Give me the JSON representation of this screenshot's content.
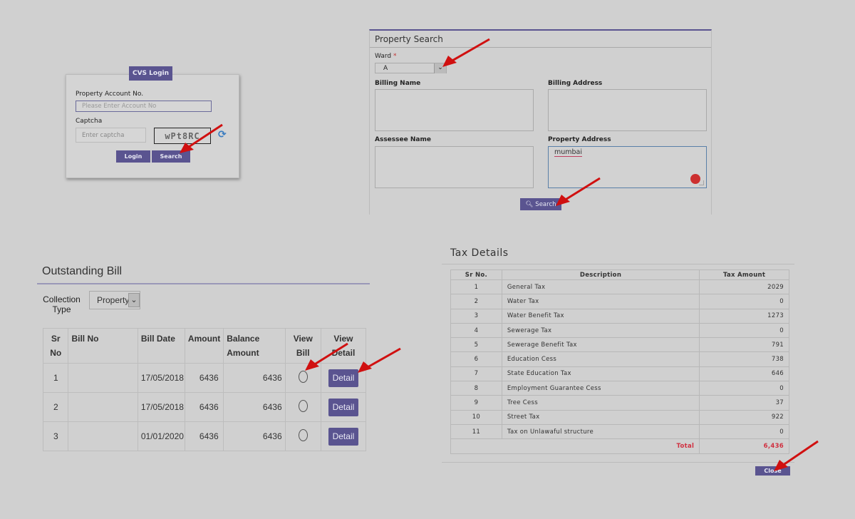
{
  "login": {
    "title": "CVS Login",
    "account_label": "Property Account No.",
    "account_placeholder": "Please Enter Account No",
    "captcha_label": "Captcha",
    "captcha_placeholder": "Enter captcha",
    "captcha_text": "wPt8RC",
    "refresh_icon": "refresh-icon",
    "login_button": "Login",
    "search_button": "Search"
  },
  "property_search": {
    "title": "Property Search",
    "ward_label": "Ward",
    "ward_required": "*",
    "ward_value": "A",
    "billing_name_label": "Billing Name",
    "billing_name_value": "",
    "billing_address_label": "Billing Address",
    "billing_address_value": "",
    "assessee_name_label": "Assessee Name",
    "assessee_name_value": "",
    "property_address_label": "Property Address",
    "property_address_value": "mumbai",
    "search_button": "Search",
    "search_icon": "search-icon"
  },
  "outstanding": {
    "title": "Outstanding Bill",
    "collection_type_label": "Collection Type",
    "collection_type_value": "Property",
    "headers": [
      "Sr No",
      "Bill No",
      "Bill Date",
      "Amount",
      "Balance Amount",
      "View Bill",
      "View Detail"
    ],
    "rows": [
      {
        "sr": "1",
        "bill_no": "",
        "date": "17/05/2018",
        "amount": "6436",
        "balance": "6436",
        "detail": "Detail"
      },
      {
        "sr": "2",
        "bill_no": "",
        "date": "17/05/2018",
        "amount": "6436",
        "balance": "6436",
        "detail": "Detail"
      },
      {
        "sr": "3",
        "bill_no": "",
        "date": "01/01/2020",
        "amount": "6436",
        "balance": "6436",
        "detail": "Detail"
      }
    ]
  },
  "tax": {
    "title": "Tax Details",
    "headers": [
      "Sr No.",
      "Description",
      "Tax Amount"
    ],
    "rows": [
      {
        "sr": "1",
        "desc": "General Tax",
        "amt": "2029"
      },
      {
        "sr": "2",
        "desc": "Water Tax",
        "amt": "0"
      },
      {
        "sr": "3",
        "desc": "Water Benefit Tax",
        "amt": "1273"
      },
      {
        "sr": "4",
        "desc": "Sewerage Tax",
        "amt": "0"
      },
      {
        "sr": "5",
        "desc": "Sewerage Benefit Tax",
        "amt": "791"
      },
      {
        "sr": "6",
        "desc": "Education Cess",
        "amt": "738"
      },
      {
        "sr": "7",
        "desc": "State Education Tax",
        "amt": "646"
      },
      {
        "sr": "8",
        "desc": "Employment Guarantee Cess",
        "amt": "0"
      },
      {
        "sr": "9",
        "desc": "Tree Cess",
        "amt": "37"
      },
      {
        "sr": "10",
        "desc": "Street Tax",
        "amt": "922"
      },
      {
        "sr": "11",
        "desc": "Tax on Unlawaful structure",
        "amt": "0"
      }
    ],
    "total_label": "Total",
    "total_value": "6,436",
    "close_button": "Close"
  },
  "colors": {
    "accent": "#5a5490",
    "annotation_arrow": "#d01010",
    "total_red": "#d03040"
  }
}
